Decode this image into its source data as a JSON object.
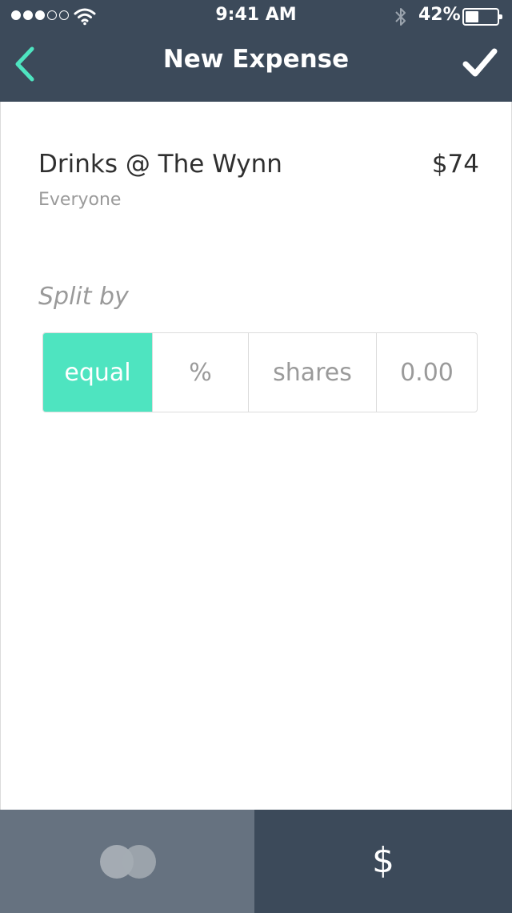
{
  "status_bar": {
    "time": "9:41 AM",
    "battery_text": "42%",
    "battery_level": 0.42,
    "signal_bars_filled": 3,
    "signal_bars_total": 5
  },
  "header": {
    "title": "New Expense",
    "back_icon": "chevron-left-icon",
    "confirm_icon": "checkmark-icon"
  },
  "expense": {
    "name": "Drinks @ The Wynn",
    "amount": "$74",
    "participants": "Everyone"
  },
  "split": {
    "label": "Split by",
    "options": [
      {
        "label": "equal",
        "active": true
      },
      {
        "label": "%",
        "active": false
      },
      {
        "label": "shares",
        "active": false
      },
      {
        "label": "0.00",
        "active": false
      }
    ]
  },
  "footer": {
    "left_icon": "split-circles-icon",
    "right_label": "$"
  },
  "colors": {
    "header_bg": "#3c4a5a",
    "accent": "#4ee4c0",
    "footer_left_bg": "#667280",
    "muted_text": "#9a9a9a"
  }
}
